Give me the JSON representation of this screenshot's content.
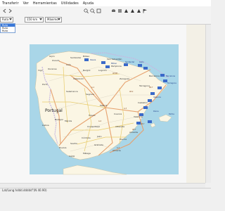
{
  "menu": {
    "items": [
      "Transferir",
      "Ver",
      "Herramientas",
      "Utilidades",
      "Ayuda"
    ]
  },
  "toolbar": {
    "zoom_combo_value": "150 km",
    "detail_combo_value": "Máximo",
    "layer_combo_value": "Ruta",
    "dropdown_options": [
      "Ruta",
      "Ruta",
      "Ruta"
    ],
    "nav_icons": [
      "back-icon",
      "forward-icon",
      "zoom-in-icon",
      "zoom-out-icon"
    ],
    "right_icons": [
      "print-icon",
      "transfer-icon",
      "waypoint-icon",
      "track-icon",
      "route-icon"
    ]
  },
  "map": {
    "country_label": "Portugal",
    "cities": [
      "Bilbao",
      "San Sebastián",
      "Gijón",
      "Oviedo",
      "Santander",
      "Pamplona",
      "Vigo",
      "Ourense",
      "León",
      "Burgos",
      "Logroño",
      "Zaragoza",
      "Valladolid",
      "Barcelona",
      "Tarragona",
      "Porto",
      "Salamanca",
      "Segovia",
      "Madrid",
      "Toledo",
      "Cuenca",
      "Valencia",
      "Castellón",
      "Badajoz",
      "Mérida",
      "Ciudad Real",
      "Albacete",
      "Alicante",
      "Murcia",
      "Lisboa",
      "Córdoba",
      "Jaén",
      "Sevilla",
      "Granada",
      "Almería",
      "Málaga",
      "Huelva",
      "Cádiz"
    ],
    "highway_labels": [
      "AP-68",
      "A-1",
      "AP-2",
      "AP-7",
      "AP-7",
      "A-7",
      "A-3",
      "A-4",
      "AP-7"
    ],
    "poi_labels": [
      "Pasaia",
      "Bilbao",
      "Santander",
      "Gijón",
      "Barcelona",
      "Tarragona",
      "Valencia",
      "Dénia",
      "Palma"
    ],
    "colors": {
      "sea": "#a9d6e8",
      "land": "#fbf6e4",
      "border": "#c7b7e0",
      "motorway": "#e6a16e",
      "main_road": "#e7cb6b",
      "marker": "#3a69c9"
    }
  },
  "status": {
    "text": "Lat/Long hddd.ddddd°(N 40.90)"
  }
}
